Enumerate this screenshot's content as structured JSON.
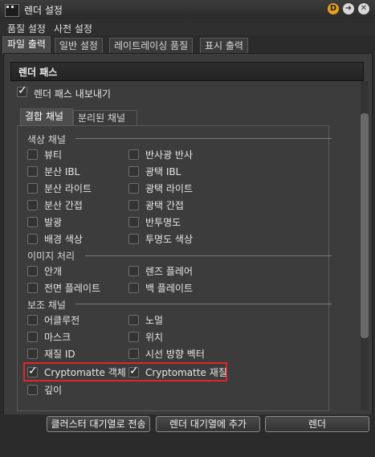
{
  "window": {
    "title": "렌더 설정",
    "badge": "D"
  },
  "menu": [
    "품질 설정",
    "사전 설정"
  ],
  "tabs": [
    "파일 출력",
    "일반 설정",
    "레이트레이싱 품질",
    "표시 출력"
  ],
  "section": {
    "title": "렌더 패스",
    "export_label": "렌더 패스 내보내기",
    "export_checked": true
  },
  "inner_tabs": [
    "결합 채널",
    "분리된 채널"
  ],
  "groups": {
    "color": {
      "title": "색상 채널",
      "items": [
        {
          "label": "뷰티",
          "checked": false
        },
        {
          "label": "반사광 반사",
          "checked": false
        },
        {
          "label": "분산 IBL",
          "checked": false
        },
        {
          "label": "광택 IBL",
          "checked": false
        },
        {
          "label": "분산 라이트",
          "checked": false
        },
        {
          "label": "광택 라이트",
          "checked": false
        },
        {
          "label": "분산 간접",
          "checked": false
        },
        {
          "label": "광택 간접",
          "checked": false
        },
        {
          "label": "발광",
          "checked": false
        },
        {
          "label": "반투명도",
          "checked": false
        },
        {
          "label": "배경 색상",
          "checked": false
        },
        {
          "label": "투명도 색상",
          "checked": false
        }
      ]
    },
    "image": {
      "title": "이미지 처리",
      "items": [
        {
          "label": "안개",
          "checked": false
        },
        {
          "label": "렌즈 플레어",
          "checked": false
        },
        {
          "label": "전면 플레이트",
          "checked": false
        },
        {
          "label": "백 플레이트",
          "checked": false
        }
      ]
    },
    "aux": {
      "title": "보조 채널",
      "items": [
        {
          "label": "어클루전",
          "checked": false
        },
        {
          "label": "노멀",
          "checked": false
        },
        {
          "label": "마스크",
          "checked": false
        },
        {
          "label": "위치",
          "checked": false
        },
        {
          "label": "재질 ID",
          "checked": false
        },
        {
          "label": "시선 방향 벡터",
          "checked": false
        },
        {
          "label": "Cryptomatte 객체",
          "checked": true
        },
        {
          "label": "Cryptomatte 재질",
          "checked": true
        },
        {
          "label": "깊이",
          "checked": false
        }
      ]
    }
  },
  "buttons": [
    "클러스터 대기열로 전송",
    "렌더 대기열에 추가",
    "렌더"
  ],
  "colors": {
    "highlight": "#e0242d",
    "badge_orange": "#e8a01c"
  }
}
